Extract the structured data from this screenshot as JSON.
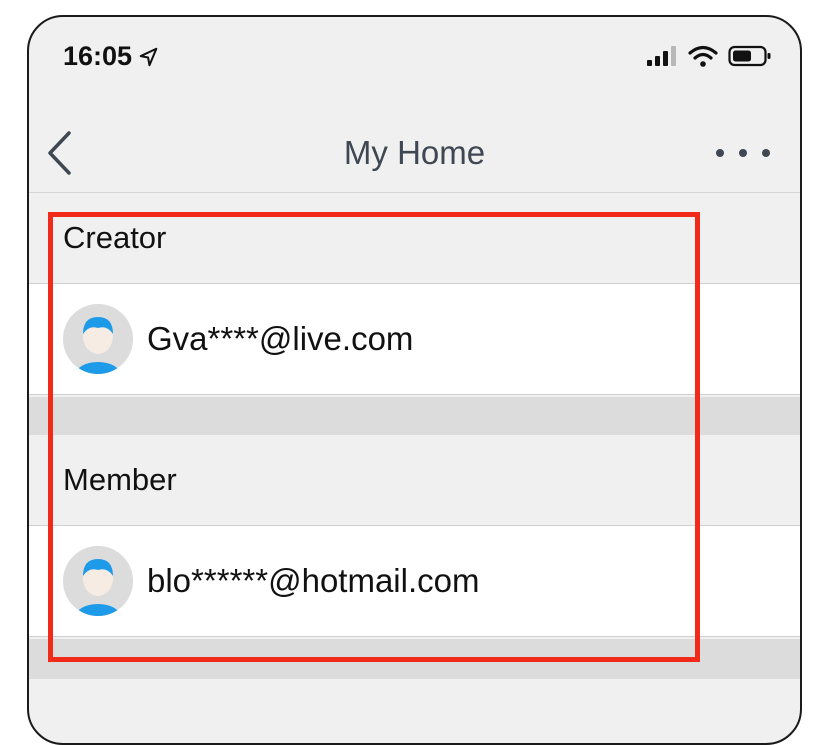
{
  "status_bar": {
    "time": "16:05",
    "icons": [
      "location-arrow-icon",
      "signal-icon",
      "wifi-icon",
      "battery-icon"
    ]
  },
  "nav": {
    "title": "My Home",
    "back_icon": "chevron-left-icon",
    "more_icon": "ellipsis-icon"
  },
  "sections": [
    {
      "header": "Creator",
      "user": {
        "email": "Gva****@live.com",
        "avatar_icon": "avatar-icon"
      }
    },
    {
      "header": "Member",
      "user": {
        "email": "blo******@hotmail.com",
        "avatar_icon": "avatar-icon"
      }
    }
  ],
  "colors": {
    "highlight": "#f22a1a",
    "avatar_accent": "#1e9be8",
    "background": "#f0f0f0",
    "band": "#dcdcdc"
  }
}
